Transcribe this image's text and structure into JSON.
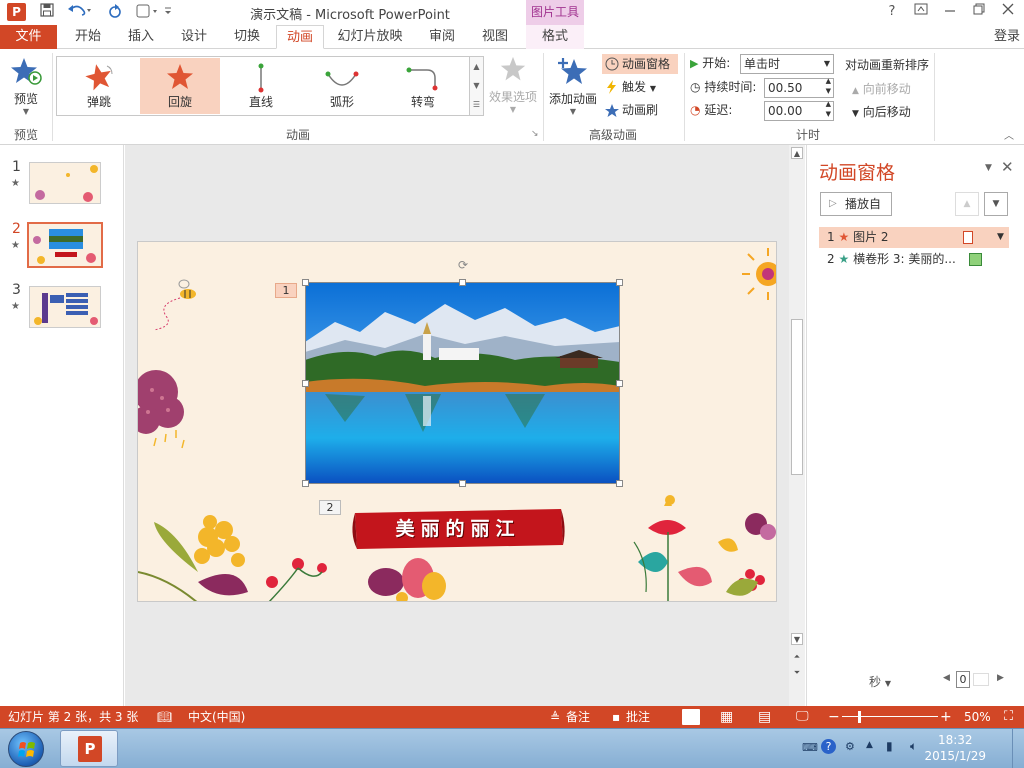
{
  "titlebar": {
    "app_icon": "P",
    "doc_title": "演示文稿 - Microsoft PowerPoint",
    "context_tools": "图片工具",
    "help": "?",
    "window_controls": [
      "restore-ribbon",
      "minimize",
      "maximize",
      "close"
    ]
  },
  "tabs": {
    "file": "文件",
    "items": [
      "开始",
      "插入",
      "设计",
      "切换",
      "动画",
      "幻灯片放映",
      "审阅",
      "视图",
      "格式"
    ],
    "active": "动画",
    "login": "登录"
  },
  "ribbon": {
    "preview": {
      "label": "预览",
      "group": "预览"
    },
    "animation_group": {
      "label": "动画",
      "items": [
        {
          "label": "弹跳",
          "icon": "bounce-star-icon"
        },
        {
          "label": "回旋",
          "icon": "swivel-star-icon",
          "selected": true
        },
        {
          "label": "直线",
          "icon": "line-path-icon"
        },
        {
          "label": "弧形",
          "icon": "arc-path-icon"
        },
        {
          "label": "转弯",
          "icon": "turn-path-icon"
        }
      ],
      "effect_options": "效果选项"
    },
    "advanced": {
      "label": "高级动画",
      "add_animation": "添加动画",
      "animation_pane": "动画窗格",
      "trigger": "触发",
      "painter": "动画刷"
    },
    "timing": {
      "label": "计时",
      "start_label": "开始:",
      "start_value": "单击时",
      "duration_label": "持续时间:",
      "duration_value": "00.50",
      "delay_label": "延迟:",
      "delay_value": "00.00",
      "reorder_title": "对动画重新排序",
      "move_earlier": "向前移动",
      "move_later": "向后移动"
    }
  },
  "slides": [
    {
      "num": "1",
      "star": "★"
    },
    {
      "num": "2",
      "star": "★",
      "selected": true
    },
    {
      "num": "3",
      "star": "★"
    }
  ],
  "slide": {
    "tag1": "1",
    "tag2": "2",
    "banner_text": "美丽的丽江"
  },
  "anim_pane": {
    "title": "动画窗格",
    "play_from": "播放自",
    "rows": [
      {
        "num": "1",
        "label": "图片 2",
        "selected": true
      },
      {
        "num": "2",
        "label": "横卷形 3: 美丽的..."
      }
    ],
    "seconds": "秒",
    "zoom_val": "0"
  },
  "status": {
    "slide_info": "幻灯片 第 2 张，共 3 张",
    "language": "中文(中国)",
    "notes": "备注",
    "comments": "批注",
    "zoom": "50%"
  },
  "taskbar": {
    "time": "18:32",
    "date": "2015/1/29"
  },
  "colors": {
    "accent": "#d24726",
    "selection": "#f9d2bf",
    "banner": "#c3151c"
  }
}
